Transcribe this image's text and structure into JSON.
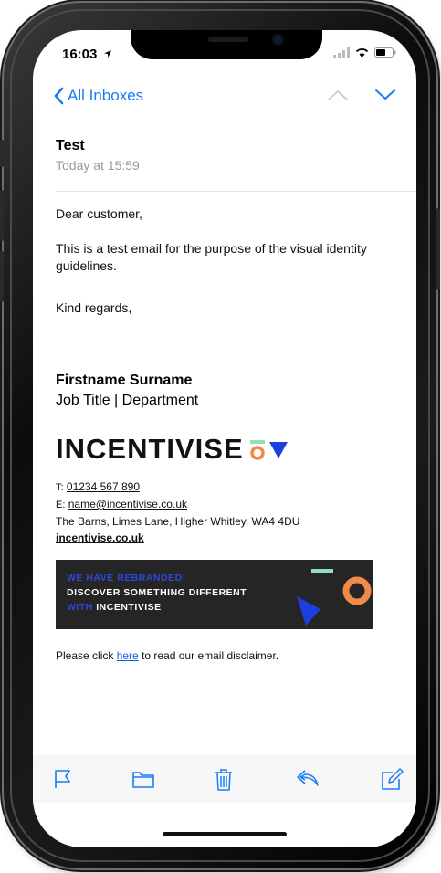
{
  "status": {
    "time": "16:03"
  },
  "nav": {
    "back_label": "All Inboxes"
  },
  "email": {
    "subject": "Test",
    "date": "Today at 15:59",
    "greeting": "Dear customer,",
    "body": "This is a test email for the purpose of the visual identity guidelines.",
    "closing": "Kind regards,"
  },
  "signature": {
    "name": "Firstname Surname",
    "title": "Job Title | Department",
    "logo_text": "INCENTIVISE",
    "phone_label": "T:",
    "phone": "01234 567 890",
    "email_label": "E:",
    "email": "name@incentivise.co.uk",
    "address": "The Barns, Limes Lane, Higher Whitley, WA4 4DU",
    "website": "incentivise.co.uk"
  },
  "banner": {
    "line1": "WE HAVE REBRANDED!",
    "line2": "DISCOVER SOMETHING DIFFERENT",
    "line3_prefix": "WITH",
    "line3_brand": "INCENTIVISE"
  },
  "disclaimer": {
    "before": "Please click ",
    "link": "here",
    "after": " to read our email disclaimer."
  },
  "colors": {
    "accent": "#1a7cf5",
    "brand_mint": "#8fe0b8",
    "brand_orange": "#f08a4b",
    "brand_blue": "#1d3fe0",
    "toolbar_icon": "#1a7cf5"
  },
  "icons": [
    "flag-icon",
    "folder-icon",
    "trash-icon",
    "reply-icon",
    "compose-icon"
  ]
}
